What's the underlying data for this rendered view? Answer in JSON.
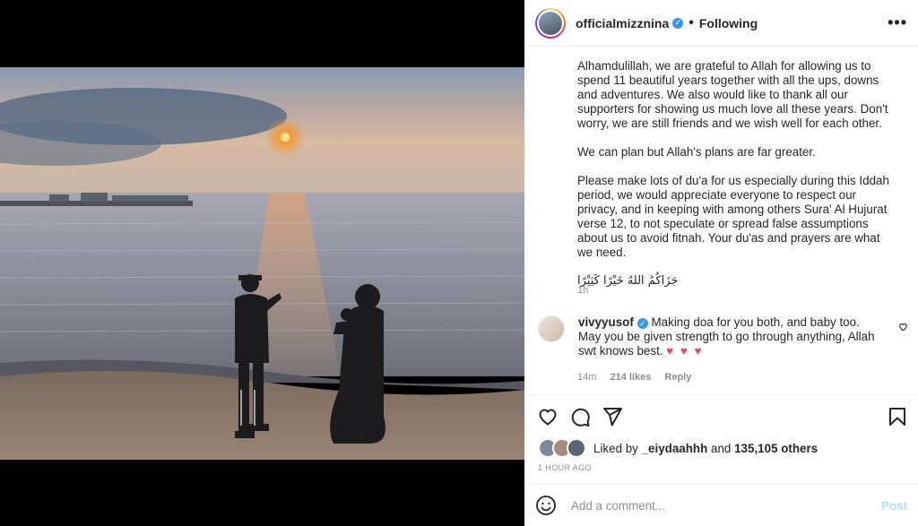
{
  "post": {
    "username": "officialmizznina",
    "following_label": "Following",
    "more_label": "•••",
    "caption_paragraphs": [
      "Alhamdulillah, we are grateful to Allah for allowing us to spend 11 beautiful years together with all the ups, downs and adventures. We also would like to thank all our supporters for showing us much love all these years. Don't worry, we are still friends and we wish well for each other.",
      "We can plan but Allah's plans are far greater.",
      "Please make lots of du'a for us especially during this Iddah period, we would appreciate everyone to respect our privacy, and in keeping with among others Sura' Al Hujurat verse 12, to not speculate or spread false assumptions about us to avoid fitnah. Your du'as and prayers are what we need.",
      "جَزَاكُمُ اللهُ خَيْرًا كَثِيْرًا"
    ],
    "caption_time": "1h"
  },
  "comment": {
    "username": "vivyyusof",
    "text": "Making doa for you both, and baby too. May you be given strength to go through anything, Allah swt knows best.",
    "hearts": "♥ ♥ ♥",
    "time": "14m",
    "likes": "214 likes",
    "reply": "Reply"
  },
  "likes": {
    "prefix": "Liked by",
    "user": "_eiydaahhh",
    "and": "and",
    "others": "135,105 others"
  },
  "posted_ago": "1 HOUR AGO",
  "add_comment": {
    "placeholder": "Add a comment...",
    "post_label": "Post"
  },
  "colors": {
    "link_blue": "#3897f0",
    "post_disabled": "#b2dffc",
    "heart_red": "#ed4956"
  },
  "icons": [
    "heart-icon",
    "comment-icon",
    "share-icon",
    "bookmark-icon",
    "emoji-icon",
    "more-icon",
    "verified-icon"
  ]
}
